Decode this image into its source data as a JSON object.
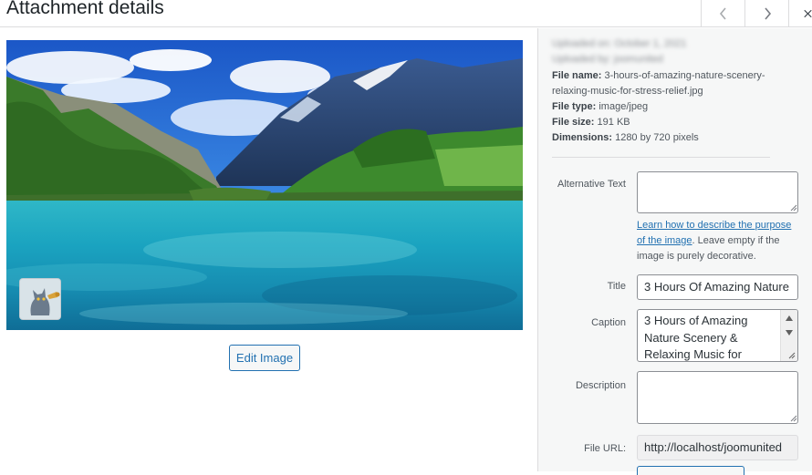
{
  "header": {
    "title": "Attachment details",
    "prev_icon": "chevron-left-icon",
    "next_icon": "chevron-right-icon",
    "close_icon": "close-icon"
  },
  "preview": {
    "edit_button": "Edit Image"
  },
  "details": {
    "uploaded_on": "Uploaded on: October 1, 2021",
    "uploaded_by": "Uploaded by: joomunited",
    "file_name_label": "File name:",
    "file_name_line1": "3-hours-of-amazing-nature-scenery-",
    "file_name_line2": "relaxing-music-for-stress-relief.jpg",
    "file_type_label": "File type:",
    "file_type": "image/jpeg",
    "file_size_label": "File size:",
    "file_size": "191 KB",
    "dimensions_label": "Dimensions:",
    "dimensions": "1280 by 720 pixels"
  },
  "form": {
    "alt_label": "Alternative Text",
    "alt_value": "",
    "help_link": "Learn how to describe the purpose of the image",
    "help_text": ". Leave empty if the image is purely decorative.",
    "title_label": "Title",
    "title_value": "3 Hours Of Amazing Nature",
    "caption_label": "Caption",
    "caption_value": "3 Hours of Amazing Nature Scenery & Relaxing Music for",
    "description_label": "Description",
    "description_value": "",
    "file_url_label": "File URL:",
    "file_url_value": "http://localhost/joomunited"
  },
  "colors": {
    "accent": "#2271b1",
    "sidebar_bg": "#f6f7f7",
    "border": "#dcdcde"
  }
}
